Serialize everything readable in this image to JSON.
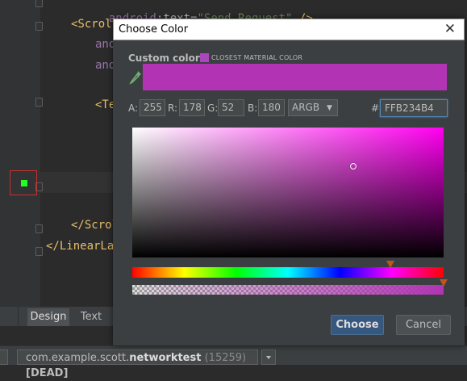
{
  "editor": {
    "lines": [
      {
        "text": "android:text=\"Send Request\" />",
        "segments": [
          {
            "text": "android",
            "color": "#9876aa"
          },
          {
            "text": ":",
            "color": "#bababa"
          },
          {
            "text": "text",
            "color": "#bababa"
          },
          {
            "text": "=",
            "color": "#bababa"
          },
          {
            "text": "\"Send Request\"",
            "color": "#6a8759"
          },
          {
            "text": " />",
            "color": "#e8bf6a"
          }
        ]
      },
      {
        "text": "<ScrollView"
      },
      {
        "text": "andr"
      },
      {
        "text": "andr"
      },
      {
        "text": "<Tex"
      },
      {
        "text": "</ScrollView>"
      },
      {
        "text": "</LinearLayout>"
      }
    ],
    "color_marker": "#22ff22"
  },
  "bottom_tabs": {
    "design": "Design",
    "text": "Text"
  },
  "status_bar": {
    "process_prefix": "com.example.scott.",
    "process_name": "networktest",
    "process_pid": "(15259)",
    "process_state": "[DEAD]"
  },
  "dialog": {
    "title": "Choose Color",
    "close_glyph": "✕",
    "custom_color_label": "Custom color",
    "closest_material_label": "CLOSEST MATERIAL COLOR",
    "closest_material_color": "#ab47bc",
    "preview_color": "#b234b4",
    "a_label": "A:",
    "a_value": "255",
    "r_label": "R:",
    "r_value": "178",
    "g_label": "G:",
    "g_value": "52",
    "b_label": "B:",
    "b_value": "180",
    "format": "ARGB",
    "format_arrow": "▼",
    "hash_label": "#",
    "hex_value": "FFB234B4",
    "hue_color": "#ff00f0",
    "saturation_level": 0.71,
    "brightness_level": 0.7,
    "hue_level": 0.83,
    "alpha_level": 1.0,
    "choose_label": "Choose",
    "cancel_label": "Cancel"
  }
}
